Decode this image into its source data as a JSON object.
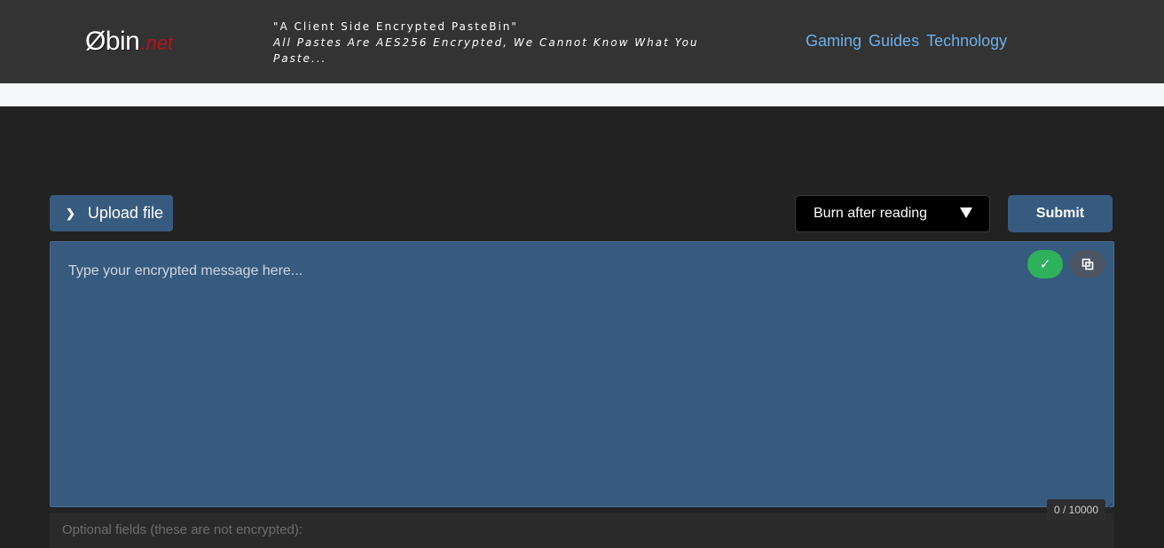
{
  "header": {
    "logo_main": "Øbin",
    "logo_tld": ".net",
    "tagline_line1": "\"A Client Side Encrypted PasteBin\"",
    "tagline_line2": "All Pastes Are AES256 Encrypted, We Cannot Know What You Paste...",
    "nav": [
      {
        "label": "Gaming"
      },
      {
        "label": "Guides"
      },
      {
        "label": "Technology"
      }
    ]
  },
  "toolbar": {
    "upload_label": "Upload file",
    "expiration_selected": "Burn after reading",
    "submit_label": "Submit"
  },
  "editor": {
    "placeholder": "Type your encrypted message here...",
    "value": "",
    "counter": "0 / 10000",
    "check_symbol": "✓"
  },
  "optional": {
    "label": "Optional fields (these are not encrypted):"
  },
  "colors": {
    "accent": "#375a7f",
    "brand_tld": "#b3121b",
    "nav_link": "#6fb0ea",
    "success": "#2fb15b"
  },
  "icons": {
    "upload": "chevron-right-icon",
    "dropdown": "caret-down-icon",
    "check": "check-icon",
    "copy": "copy-icon"
  }
}
